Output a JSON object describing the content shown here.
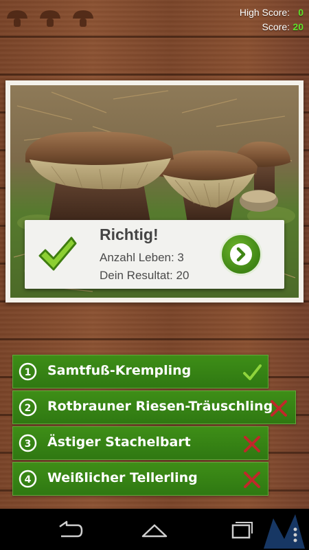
{
  "header": {
    "lives_icon": "mushroom-icon",
    "lives_count": 3,
    "high_score_label": "High Score:",
    "high_score_value": "0",
    "score_label": "Score:",
    "score_value": "20",
    "score_color": "#5fe02a"
  },
  "result": {
    "title": "Richtig!",
    "lives_line": "Anzahl Leben: 3",
    "score_line": "Dein Resultat: 20",
    "check_icon": "checkmark-icon",
    "next_icon": "chevron-right-icon"
  },
  "answers": [
    {
      "number": "1",
      "label": "Samtfuß-Krempling",
      "status": "correct",
      "status_icon": "checkmark-icon"
    },
    {
      "number": "2",
      "label": "Rotbrauner Riesen-Träuschling",
      "status": "wrong",
      "status_icon": "x-icon"
    },
    {
      "number": "3",
      "label": "Ästiger Stachelbart",
      "status": "wrong",
      "status_icon": "x-icon"
    },
    {
      "number": "4",
      "label": "Weißlicher Tellerling",
      "status": "wrong",
      "status_icon": "x-icon"
    }
  ],
  "navbar": {
    "back_icon": "back-icon",
    "home_icon": "home-icon",
    "recents_icon": "recent-apps-icon"
  },
  "colors": {
    "answer_green": "#3e8e17",
    "correct_mark": "#8fd43c",
    "wrong_mark": "#c0282a"
  }
}
